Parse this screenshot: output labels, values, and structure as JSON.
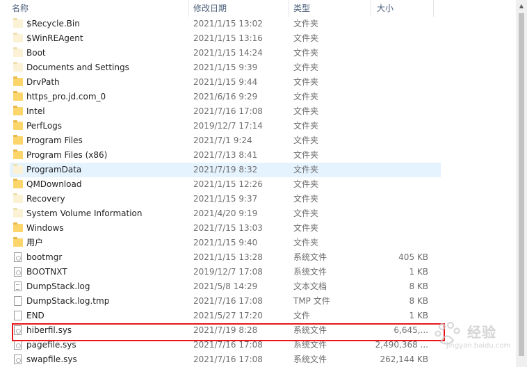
{
  "columns": {
    "name": "名称",
    "date": "修改日期",
    "type": "类型",
    "size": "大小"
  },
  "rows": [
    {
      "name": "$Recycle.Bin",
      "date": "2021/1/15 13:02",
      "type": "文件夹",
      "size": "",
      "icon": "folder-light-icon"
    },
    {
      "name": "$WinREAgent",
      "date": "2021/1/15 13:16",
      "type": "文件夹",
      "size": "",
      "icon": "folder-light-icon"
    },
    {
      "name": "Boot",
      "date": "2021/1/15 14:24",
      "type": "文件夹",
      "size": "",
      "icon": "folder-light-icon"
    },
    {
      "name": "Documents and Settings",
      "date": "2021/1/15 9:39",
      "type": "文件夹",
      "size": "",
      "icon": "folder-light-icon"
    },
    {
      "name": "DrvPath",
      "date": "2021/1/15 9:44",
      "type": "文件夹",
      "size": "",
      "icon": "folder-icon"
    },
    {
      "name": "https_pro.jd.com_0",
      "date": "2021/6/16 9:29",
      "type": "文件夹",
      "size": "",
      "icon": "folder-icon"
    },
    {
      "name": "Intel",
      "date": "2021/7/16 17:08",
      "type": "文件夹",
      "size": "",
      "icon": "folder-icon"
    },
    {
      "name": "PerfLogs",
      "date": "2019/12/7 17:14",
      "type": "文件夹",
      "size": "",
      "icon": "folder-icon"
    },
    {
      "name": "Program Files",
      "date": "2021/7/1 9:24",
      "type": "文件夹",
      "size": "",
      "icon": "folder-icon"
    },
    {
      "name": "Program Files (x86)",
      "date": "2021/7/13 8:41",
      "type": "文件夹",
      "size": "",
      "icon": "folder-icon"
    },
    {
      "name": "ProgramData",
      "date": "2021/7/19 8:32",
      "type": "文件夹",
      "size": "",
      "icon": "folder-light-icon"
    },
    {
      "name": "QMDownload",
      "date": "2021/1/15 12:26",
      "type": "文件夹",
      "size": "",
      "icon": "folder-icon"
    },
    {
      "name": "Recovery",
      "date": "2021/1/15 9:37",
      "type": "文件夹",
      "size": "",
      "icon": "folder-light-icon"
    },
    {
      "name": "System Volume Information",
      "date": "2021/4/20 9:19",
      "type": "文件夹",
      "size": "",
      "icon": "folder-light-icon"
    },
    {
      "name": "Windows",
      "date": "2021/7/15 13:03",
      "type": "文件夹",
      "size": "",
      "icon": "folder-icon"
    },
    {
      "name": "用户",
      "date": "2021/1/15 9:40",
      "type": "文件夹",
      "size": "",
      "icon": "folder-icon"
    },
    {
      "name": "bootmgr",
      "date": "2021/1/15 13:28",
      "type": "系统文件",
      "size": "405 KB",
      "icon": "system-file-icon"
    },
    {
      "name": "BOOTNXT",
      "date": "2019/12/7 17:08",
      "type": "系统文件",
      "size": "1 KB",
      "icon": "system-file-icon"
    },
    {
      "name": "DumpStack.log",
      "date": "2021/5/8 14:29",
      "type": "文本文档",
      "size": "8 KB",
      "icon": "text-file-icon"
    },
    {
      "name": "DumpStack.log.tmp",
      "date": "2021/7/16 17:08",
      "type": "TMP 文件",
      "size": "8 KB",
      "icon": "file-icon"
    },
    {
      "name": "END",
      "date": "2021/5/27 17:20",
      "type": "文件",
      "size": "1 KB",
      "icon": "file-icon"
    },
    {
      "name": "hiberfil.sys",
      "date": "2021/7/19 8:28",
      "type": "系统文件",
      "size": "6,645,...",
      "icon": "system-file-icon"
    },
    {
      "name": "pagefile.sys",
      "date": "2021/7/16 17:08",
      "type": "系统文件",
      "size": "2,490,368 ...",
      "icon": "system-file-icon"
    },
    {
      "name": "swapfile.sys",
      "date": "2021/7/16 17:08",
      "type": "系统文件",
      "size": "262,144 KB",
      "icon": "system-file-icon"
    }
  ],
  "hover_row_index": 10,
  "highlighted_row_index": 21,
  "colors": {
    "header_text": "#4c607a",
    "hover_bg": "#e5f3ff",
    "highlight_border": "#e8161a",
    "folder": "#fcd66a"
  },
  "watermark": {
    "text": "经验",
    "sub": "jingyan.baidu.com"
  }
}
